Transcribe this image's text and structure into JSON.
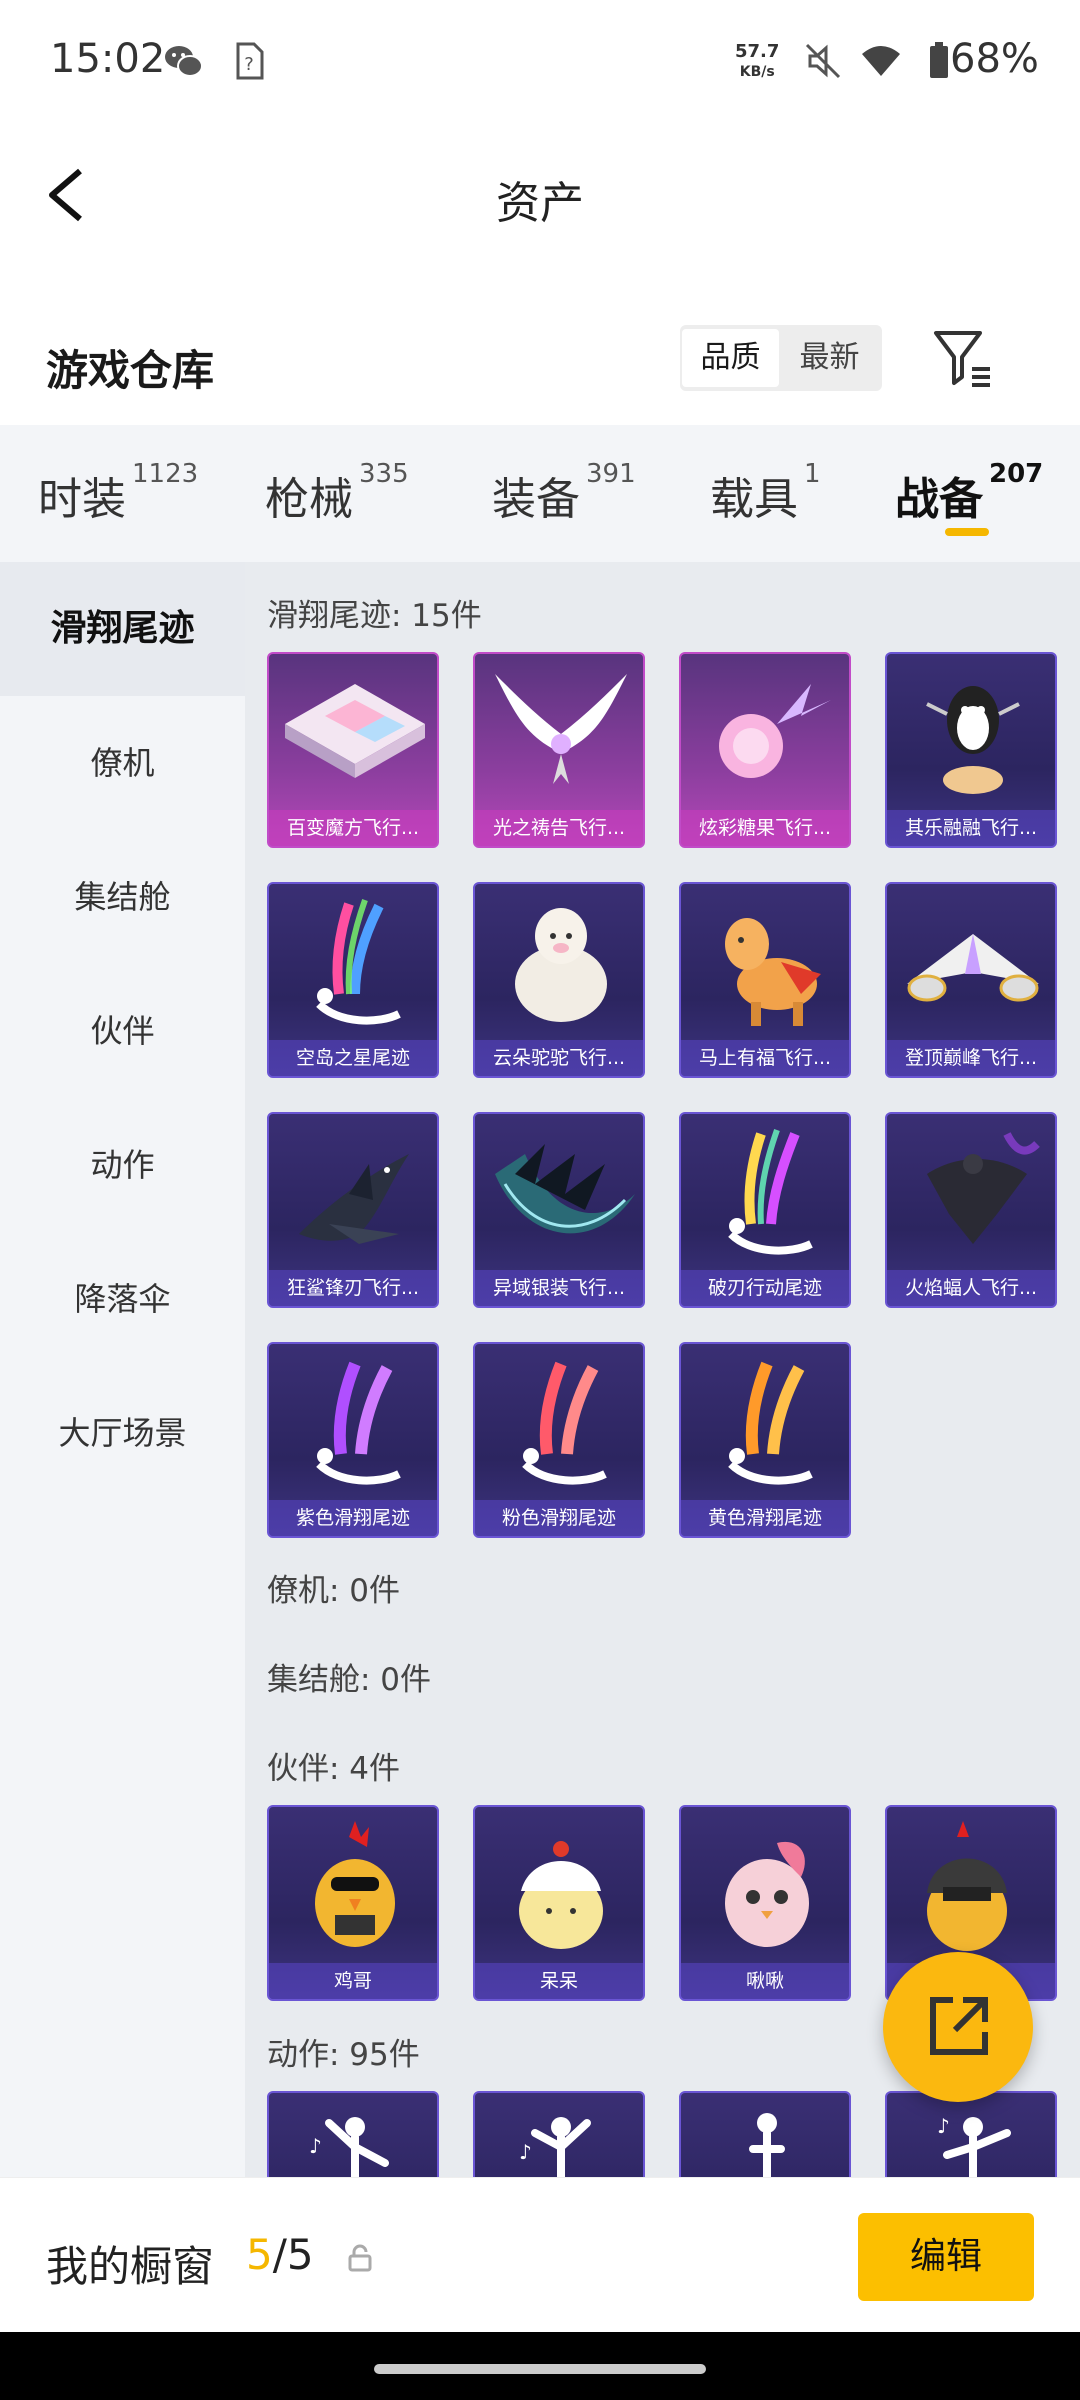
{
  "status_bar": {
    "time": "15:02",
    "net_speed_value": "57.7",
    "net_speed_unit": "KB/s",
    "battery": "68%",
    "icons": [
      "wechat-icon",
      "sim-unknown-icon",
      "mute-icon",
      "wifi-icon",
      "battery-icon"
    ]
  },
  "nav": {
    "title": "资产",
    "back_icon": "chevron-left-icon"
  },
  "header": {
    "title": "游戏仓库",
    "sort_options": [
      "品质",
      "最新"
    ],
    "sort_selected": "品质",
    "filter_icon": "filter-icon"
  },
  "tabs": [
    {
      "label": "时装",
      "count": "1123",
      "active": false
    },
    {
      "label": "枪械",
      "count": "335",
      "active": false
    },
    {
      "label": "装备",
      "count": "391",
      "active": false
    },
    {
      "label": "载具",
      "count": "1",
      "active": false
    },
    {
      "label": "战备",
      "count": "207",
      "active": true
    }
  ],
  "sidebar": {
    "items": [
      "滑翔尾迹",
      "僚机",
      "集结舱",
      "伙伴",
      "动作",
      "降落伞",
      "大厅场景"
    ],
    "active": "滑翔尾迹"
  },
  "sections": {
    "glide_trails": {
      "title": "滑翔尾迹: 15件",
      "items": [
        {
          "name": "百变魔方飞行...",
          "icon": "rubik-pad-icon",
          "rarity": "pink"
        },
        {
          "name": "光之祷告飞行...",
          "icon": "wings-icon",
          "rarity": "pink"
        },
        {
          "name": "炫彩糖果飞行...",
          "icon": "candy-icon",
          "rarity": "pink"
        },
        {
          "name": "其乐融融飞行...",
          "icon": "penguin-icon",
          "rarity": "purple"
        },
        {
          "name": "空岛之星尾迹",
          "icon": "skydiver-smoke-icon",
          "rarity": "purple"
        },
        {
          "name": "云朵驼驼飞行...",
          "icon": "alpaca-icon",
          "rarity": "purple"
        },
        {
          "name": "马上有福飞行...",
          "icon": "pony-icon",
          "rarity": "purple"
        },
        {
          "name": "登顶巅峰飞行...",
          "icon": "jet-icon",
          "rarity": "purple"
        },
        {
          "name": "狂鲨锋刃飞行...",
          "icon": "shark-icon",
          "rarity": "purple"
        },
        {
          "name": "异域银装飞行...",
          "icon": "blade-wing-icon",
          "rarity": "purple"
        },
        {
          "name": "破刃行动尾迹",
          "icon": "skydiver-smoke-icon",
          "rarity": "purple"
        },
        {
          "name": "火焰蝠人飞行...",
          "icon": "wingsuit-icon",
          "rarity": "purple"
        },
        {
          "name": "紫色滑翔尾迹",
          "icon": "skydiver-smoke-icon",
          "rarity": "purple"
        },
        {
          "name": "粉色滑翔尾迹",
          "icon": "skydiver-smoke-icon",
          "rarity": "purple"
        },
        {
          "name": "黄色滑翔尾迹",
          "icon": "skydiver-smoke-icon",
          "rarity": "purple"
        }
      ]
    },
    "wingman": {
      "title": "僚机: 0件"
    },
    "capsule": {
      "title": "集结舱: 0件"
    },
    "companion": {
      "title": "伙伴: 4件",
      "items": [
        {
          "name": "鸡哥",
          "icon": "chicken-icon"
        },
        {
          "name": "呆呆",
          "icon": "chick-icon"
        },
        {
          "name": "啾啾",
          "icon": "bird-icon"
        },
        {
          "name": "",
          "icon": "helmet-chicken-icon"
        }
      ]
    },
    "emote": {
      "title": "动作: 95件"
    }
  },
  "bottom_bar": {
    "label": "我的橱窗",
    "count_current": "5",
    "count_sep_total": "/5",
    "lock_icon": "lock-icon",
    "edit_label": "编辑"
  },
  "fab": {
    "icon": "share-export-icon"
  },
  "colors": {
    "accent": "#f5b700",
    "card_purple": "#3a2f74",
    "card_pink": "#b548b8"
  }
}
